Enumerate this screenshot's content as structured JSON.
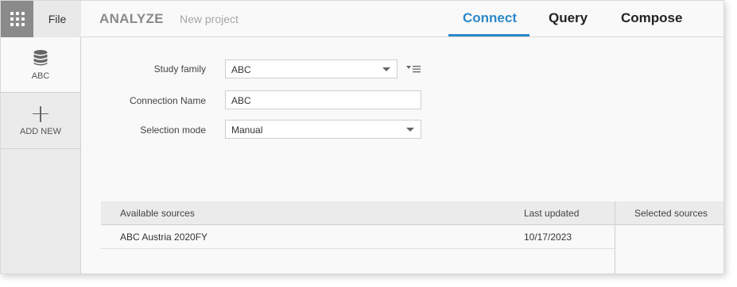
{
  "header": {
    "file_label": "File",
    "app_title": "ANALYZE",
    "project_name": "New project",
    "tabs": [
      {
        "label": "Connect",
        "active": true
      },
      {
        "label": "Query",
        "active": false
      },
      {
        "label": "Compose",
        "active": false
      }
    ]
  },
  "sidebar": {
    "items": [
      {
        "label": "ABC",
        "icon": "database-icon"
      },
      {
        "label": "ADD NEW",
        "icon": "plus-icon"
      }
    ]
  },
  "form": {
    "study_family_label": "Study family",
    "study_family_value": "ABC",
    "connection_name_label": "Connection Name",
    "connection_name_value": "ABC",
    "selection_mode_label": "Selection mode",
    "selection_mode_value": "Manual"
  },
  "sources": {
    "headers": {
      "available": "Available sources",
      "last_updated": "Last updated",
      "selected": "Selected sources"
    },
    "rows": [
      {
        "name": "ABC Austria 2020FY",
        "last_updated": "10/17/2023"
      }
    ]
  },
  "colors": {
    "accent": "#2b88c8",
    "apps_button": "#8a8a8a",
    "sidebar_bg": "#ebebeb"
  }
}
